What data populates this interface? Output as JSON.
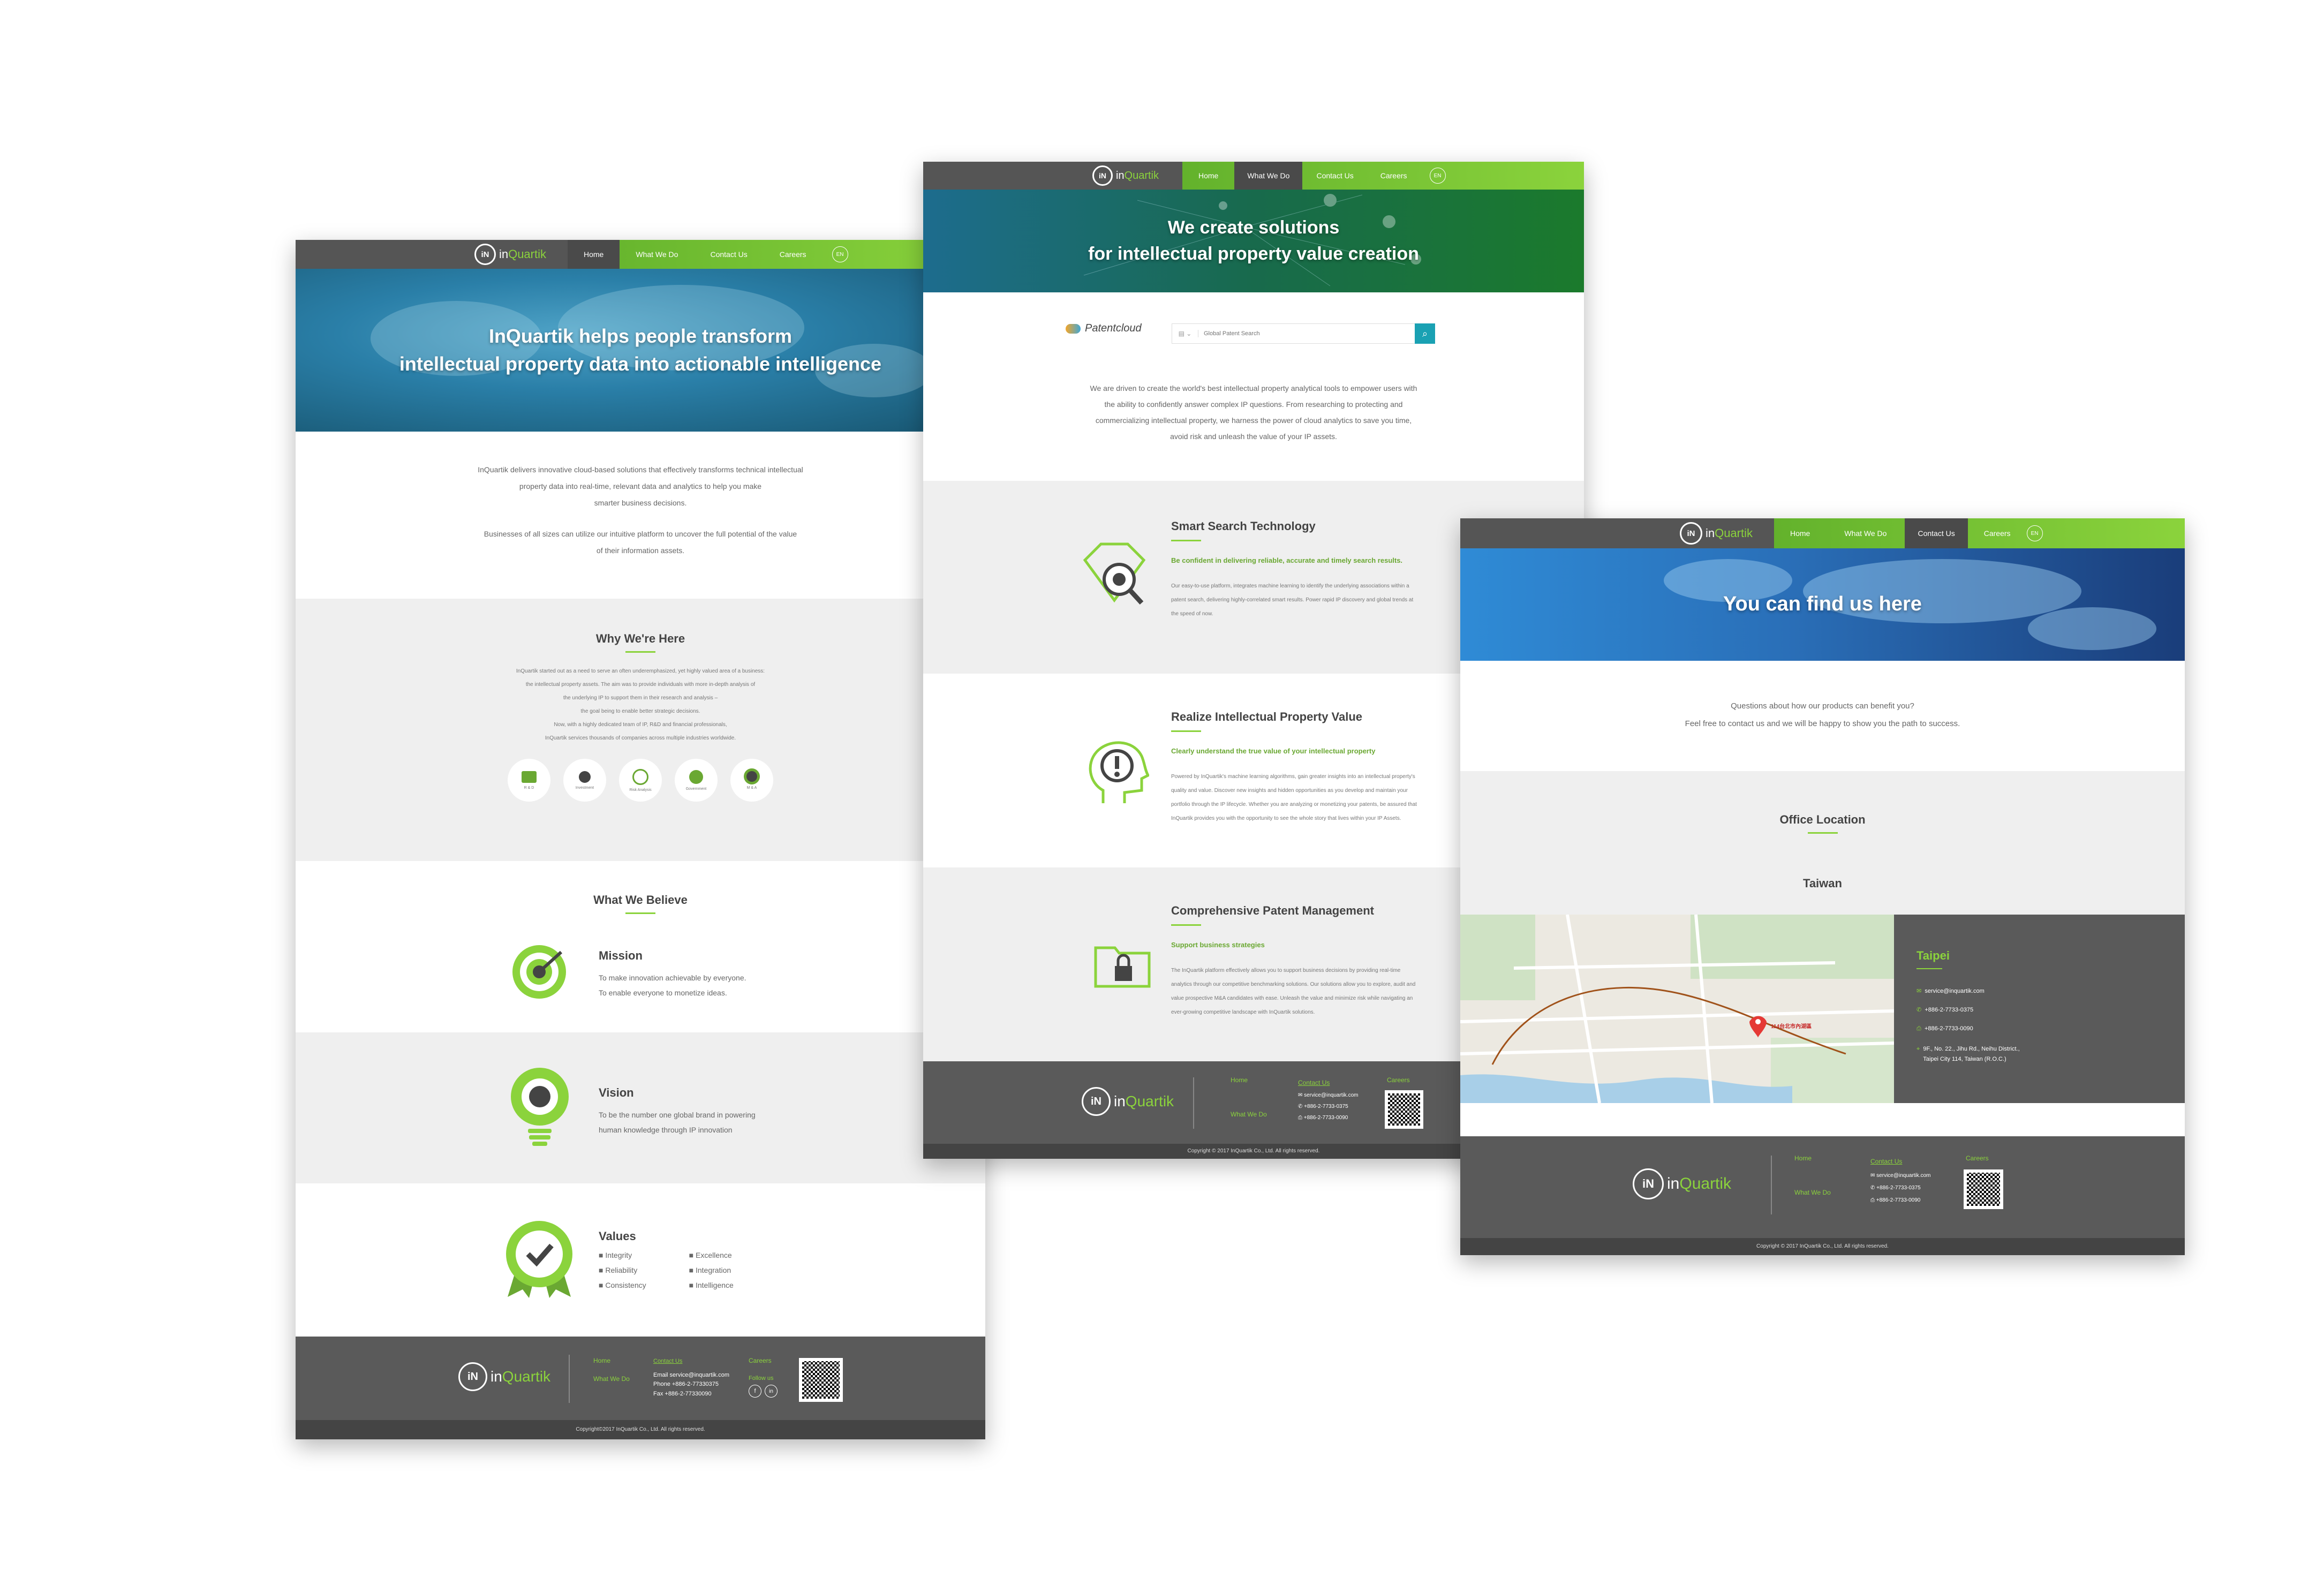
{
  "brand": {
    "logo_mark": "iN",
    "logo_prefix": "in",
    "logo_suffix": "Quartik"
  },
  "nav": {
    "home": "Home",
    "what_we_do": "What We Do",
    "contact_us": "Contact Us",
    "careers": "Careers",
    "lang": "EN"
  },
  "home": {
    "hero_line1": "InQuartik helps people transform",
    "hero_line2": "intellectual property data into actionable intelligence",
    "intro_line1": "InQuartik delivers innovative cloud-based solutions that effectively transforms technical intellectual",
    "intro_line2": "property data into real-time, relevant data and analytics to help you make",
    "intro_line3": "smarter business decisions.",
    "intro_line4": "Businesses of all sizes can utilize our intuitive platform to uncover the full potential of the value",
    "intro_line5": "of their information assets.",
    "why_title": "Why We're Here",
    "why_lines": [
      "InQuartik started out as a need to serve an often underemphasized, yet highly valued area of a business:",
      "the intellectual property assets. The aim was to provide individuals with more in-depth analysis of",
      "the underlying IP to support them in their research and analysis –",
      "the goal being to enable better strategic decisions.",
      "Now, with a highly dedicated team of IP, R&D and financial professionals,",
      "InQuartik services thousands of companies across multiple industries worldwide."
    ],
    "why_icons": [
      "R & D",
      "Investment",
      "Risk Analysis",
      "Government",
      "M & A"
    ],
    "believe_title": "What We Believe",
    "mission_title": "Mission",
    "mission_line1": "To make innovation achievable by everyone.",
    "mission_line2": "To enable everyone to monetize ideas.",
    "vision_title": "Vision",
    "vision_line1": "To be the number one global brand in powering",
    "vision_line2": "human knowledge through IP innovation",
    "values_title": "Values",
    "values_left": [
      "Integrity",
      "Reliability",
      "Consistency"
    ],
    "values_right": [
      "Excellence",
      "Integration",
      "Intelligence"
    ],
    "footer": {
      "home": "Home",
      "what_we_do": "What We Do",
      "contact_us": "Contact Us",
      "careers": "Careers",
      "follow_us": "Follow us",
      "email": "Email    service@inquartik.com",
      "phone": "Phone    +886-2-77330375",
      "fax": "Fax      +886-2-77330090",
      "copyright": "Copyright©2017 InQuartik Co., Ltd. All rights reserved."
    }
  },
  "services": {
    "hero_line1": "We create solutions",
    "hero_line2": "for intellectual property value creation",
    "patentcloud_label": "Patentcloud",
    "search_placeholder": "Global Patent Search",
    "intro_lines": [
      "We are driven to create the world's best intellectual property analytical tools to empower users with",
      "the ability to confidently answer complex IP questions. From researching to protecting and",
      "commercializing intellectual property, we harness the power of cloud analytics to save you time,",
      "avoid risk and unleash the value of your IP assets."
    ],
    "features": [
      {
        "title": "Smart Search Technology",
        "subtitle": "Be confident in delivering reliable, accurate and timely search results.",
        "lines": [
          "Our easy-to-use platform, integrates machine learning to identify the underlying associations within a",
          "patent search, delivering highly-correlated smart results. Power rapid IP discovery and global trends at",
          "the speed of now."
        ]
      },
      {
        "title": "Realize Intellectual Property Value",
        "subtitle": "Clearly understand the true value of your intellectual property",
        "lines": [
          "Powered by InQuartik's machine learning algorithms, gain greater insights into an intellectual property's",
          "quality and value. Discover new insights and hidden opportunities as you develop and maintain your",
          "portfolio through the IP lifecycle. Whether you are analyzing or monetizing your patents, be assured that",
          "InQuartik provides you with the opportunity to see the whole story that lives within your IP Assets."
        ]
      },
      {
        "title": "Comprehensive Patent Management",
        "subtitle": "Support business strategies",
        "lines": [
          "The InQuartik platform effectively allows you to support business decisions by providing real-time",
          "analytics through our competitive benchmarking solutions. Our solutions allow you to explore, audit and",
          "value prospective M&A candidates with ease. Unleash the value and minimize risk while navigating an",
          "ever-growing competitive landscape with InQuartik solutions."
        ]
      }
    ],
    "footer": {
      "home": "Home",
      "what_we_do": "What We Do",
      "contact_us": "Contact Us",
      "careers": "Careers",
      "email": "service@inquartik.com",
      "phone": "+886-2-7733-0375",
      "fax": "+886-2-7733-0090",
      "copyright": "Copyright © 2017 InQuartik Co., Ltd. All rights reserved."
    }
  },
  "contact": {
    "hero_title": "You can find us here",
    "question_line1": "Questions about how our products can benefit you?",
    "question_line2": "Feel free to contact us and we will be happy to show you the path to success.",
    "office_title": "Office Location",
    "country": "Taiwan",
    "city": "Taipei",
    "email": "service@inquartik.com",
    "phone": "+886-2-7733-0375",
    "fax": "+886-2-7733-0090",
    "address_line1": "9F., No. 22., Jihu Rd., Neihu District.,",
    "address_line2": "Taipei City 114, Taiwan (R.O.C.)",
    "map_marker_label": "114台北市內湖區",
    "footer": {
      "home": "Home",
      "what_we_do": "What We Do",
      "contact_us": "Contact Us",
      "careers": "Careers",
      "email": "service@inquartik.com",
      "phone": "+886-2-7733-0375",
      "fax": "+886-2-7733-0090",
      "copyright": "Copyright © 2017 InQuartik Co., Ltd. All rights reserved."
    }
  },
  "colors": {
    "accent_green": "#8bd33c",
    "nav_gray": "#555555",
    "footer_gray": "#5a5a5a",
    "hero_blue": "#2a7fa8",
    "hero_green": "#1a6a3a"
  }
}
